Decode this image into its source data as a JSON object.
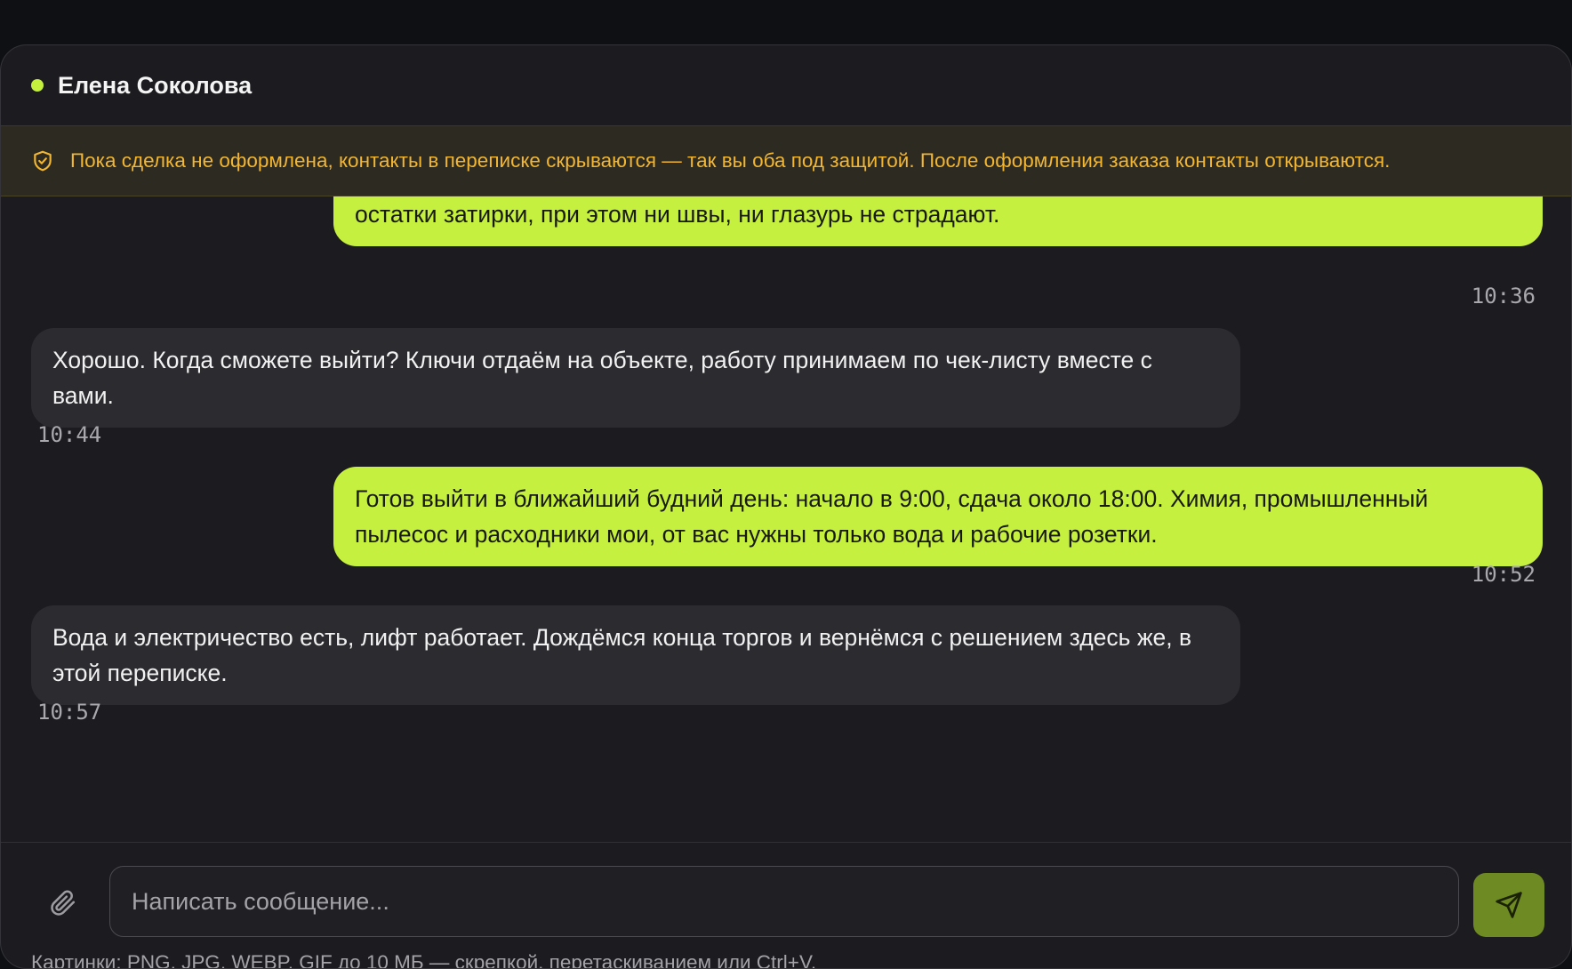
{
  "header": {
    "contact_name": "Елена Соколова"
  },
  "notice": {
    "text": "Пока сделка не оформлена, контакты в переписке скрываются — так вы оба под защитой. После оформления заказа контакты открываются."
  },
  "messages": [
    {
      "direction": "out",
      "text": "Снимем. Для этого беру профессиональную химию для послестроительной уборки: она растворяет остатки затирки, при этом ни швы, ни глазурь не страдают.",
      "time": "10:36"
    },
    {
      "direction": "in",
      "text": "Хорошо. Когда сможете выйти? Ключи отдаём на объекте, работу принимаем по чек-листу вместе с вами.",
      "time": "10:44"
    },
    {
      "direction": "out",
      "text": "Готов выйти в ближайший будний день: начало в 9:00, сдача около 18:00. Химия, промышленный пылесос и расходники мои, от вас нужны только вода и рабочие розетки.",
      "time": "10:52"
    },
    {
      "direction": "in",
      "text": "Вода и электричество есть, лифт работает. Дождёмся конца торгов и вернёмся с решением здесь же, в этой переписке.",
      "time": "10:57"
    }
  ],
  "composer": {
    "placeholder": "Написать сообщение...",
    "value": "",
    "hint": "Картинки: PNG, JPG, WEBP, GIF до 10 МБ — скрепкой, перетаскиванием или Ctrl+V."
  },
  "icons": {
    "online": "online-dot",
    "notice": "shield-check-icon",
    "attach": "paperclip-icon",
    "send": "send-icon"
  },
  "colors": {
    "accent": "#c5f03f",
    "online": "#c4ef3c",
    "notice_text": "#f2b632",
    "send_button": "#6e8a22"
  }
}
